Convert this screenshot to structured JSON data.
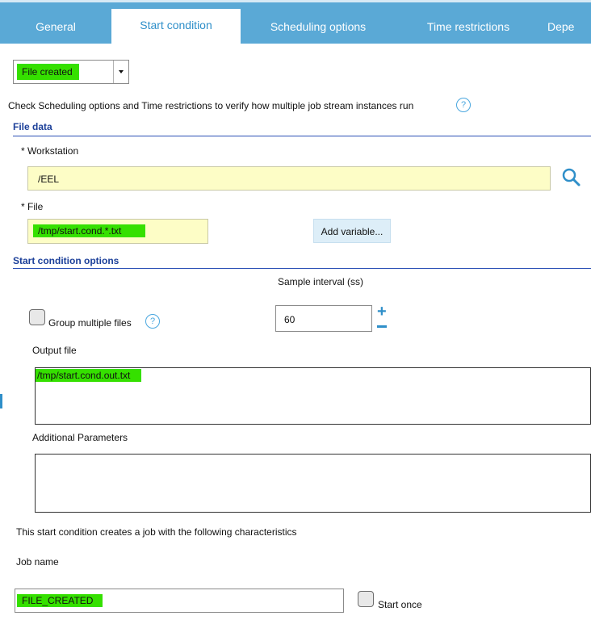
{
  "tabs": [
    {
      "label": "General",
      "active": false
    },
    {
      "label": "Start condition",
      "active": true
    },
    {
      "label": "Scheduling options",
      "active": false
    },
    {
      "label": "Time restrictions",
      "active": false
    },
    {
      "label": "Depe",
      "active": false
    }
  ],
  "condition_select": {
    "value": "File created",
    "icon": "chevron-down-icon"
  },
  "info_text": "Check Scheduling options and Time restrictions to verify how multiple job stream instances run",
  "help_icon_glyph": "?",
  "file_data": {
    "title": "File data",
    "workstation_label": "* Workstation",
    "workstation_value": "/EEL",
    "search_icon": "search-icon",
    "file_label": "* File",
    "file_value": "/tmp/start.cond.*.txt",
    "add_variable_label": "Add variable..."
  },
  "start_condition_options": {
    "title": "Start condition options",
    "sample_interval_label": "Sample interval (ss)",
    "sample_interval_value": "60",
    "group_multiple_files_label": "Group multiple files",
    "group_multiple_files_checked": false,
    "output_file_label": "Output file",
    "output_file_value": "/tmp/start.cond.out.txt",
    "additional_parameters_label": "Additional Parameters",
    "additional_parameters_value": ""
  },
  "job": {
    "description": "This start condition creates a job with the following characteristics",
    "job_name_label": "Job name",
    "job_name_value": "FILE_CREATED",
    "start_once_label": "Start once",
    "start_once_checked": false
  },
  "colors": {
    "tab_bar": "#5aa9d6",
    "active_tab_text": "#2f8fc9",
    "section_title": "#1b3f99",
    "highlight": "#35e000",
    "yellow_input": "#fdfdc6",
    "help_icon": "#4aa7df"
  }
}
